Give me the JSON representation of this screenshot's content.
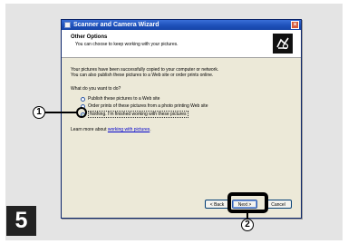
{
  "window": {
    "title": "Scanner and Camera Wizard",
    "close_glyph": "×"
  },
  "header": {
    "title": "Other Options",
    "subtitle": "You can choose to keep working with your pictures."
  },
  "body": {
    "intro_line1": "Your pictures have been successfully copied to your computer or network.",
    "intro_line2": "You can also publish these pictures to a Web site or order prints online.",
    "question": "What do you want to do?",
    "options": [
      {
        "label": "Publish these pictures to a Web site",
        "selected": false
      },
      {
        "label": "Order prints of these pictures from a photo printing Web site",
        "selected": false
      },
      {
        "label": "Nothing. I'm finished working with these pictures",
        "selected": true
      }
    ],
    "learn_prefix": "Learn more about ",
    "learn_link": "working with pictures",
    "learn_suffix": "."
  },
  "buttons": {
    "back": "< Back",
    "next": "Next >",
    "cancel": "Cancel"
  },
  "annotations": {
    "callout1": "1",
    "callout2": "2",
    "step_number": "5"
  },
  "colors": {
    "titlebar": "#1c4fb8",
    "dialog_bg": "#ece9d8",
    "link": "#0000cc"
  }
}
